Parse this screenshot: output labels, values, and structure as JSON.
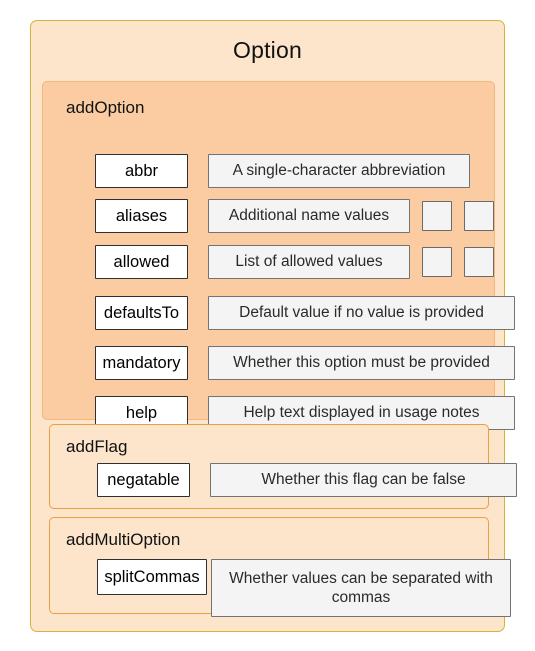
{
  "diagram": {
    "title": "Option",
    "groups": [
      {
        "name": "addOption",
        "rows": [
          {
            "key": "abbr",
            "desc": "A single-character abbreviation",
            "extras": 0
          },
          {
            "key": "aliases",
            "desc": "Additional name values",
            "extras": 2
          },
          {
            "key": "allowed",
            "desc": "List of allowed values",
            "extras": 2
          },
          {
            "key": "defaultsTo",
            "desc": "Default value if no value is provided",
            "extras": 0
          },
          {
            "key": "mandatory",
            "desc": "Whether this option must be provided",
            "extras": 0
          },
          {
            "key": "help",
            "desc": "Help text displayed in usage notes",
            "extras": 0
          }
        ]
      },
      {
        "name": "addFlag",
        "rows": [
          {
            "key": "negatable",
            "desc": "Whether this flag can be false",
            "extras": 0
          }
        ]
      },
      {
        "name": "addMultiOption",
        "rows": [
          {
            "key": "splitCommas",
            "desc": "Whether values can be separated with commas",
            "extras": 0
          }
        ]
      }
    ]
  },
  "colors": {
    "outer_background": "#fde5cb",
    "outer_border": "#d4b33c",
    "addoption_background": "#fbcca1",
    "addoption_border": "#f0b97f",
    "subgroup_background": "#fde5cb",
    "subgroup_border": "#e8a13f",
    "key_box_background": "#ffffff",
    "key_box_border": "#303030",
    "desc_box_background": "#f4f4f4",
    "desc_box_border": "#737373"
  }
}
